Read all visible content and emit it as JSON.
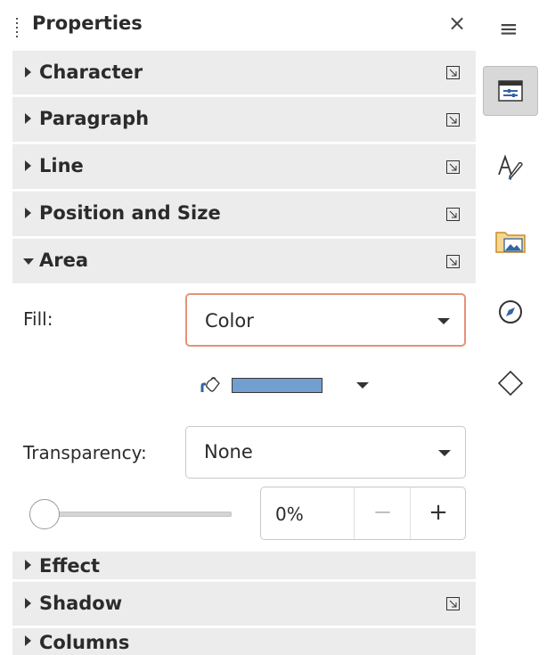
{
  "panel": {
    "title": "Properties",
    "close_glyph": "×"
  },
  "sections": {
    "character": "Character",
    "paragraph": "Paragraph",
    "line": "Line",
    "position_size": "Position and Size",
    "area": "Area",
    "effect": "Effect",
    "shadow": "Shadow",
    "columns": "Columns"
  },
  "area": {
    "fill_label": "Fill:",
    "fill_value": "Color",
    "fill_color": "#729fcf",
    "transparency_label": "Transparency:",
    "transparency_value": "None",
    "transparency_percent": "0%",
    "slider_level": 0,
    "minus_glyph": "−",
    "plus_glyph": "+"
  },
  "tabbar": {
    "menu_glyph": "≡",
    "items": [
      "properties-icon",
      "styles-icon",
      "gallery-icon",
      "navigator-icon",
      "shapes-icon"
    ],
    "active": "properties-icon"
  },
  "colors": {
    "section_bg": "#ececec",
    "focus_border": "#e8917a",
    "tab_active": "#d8d8d8"
  }
}
